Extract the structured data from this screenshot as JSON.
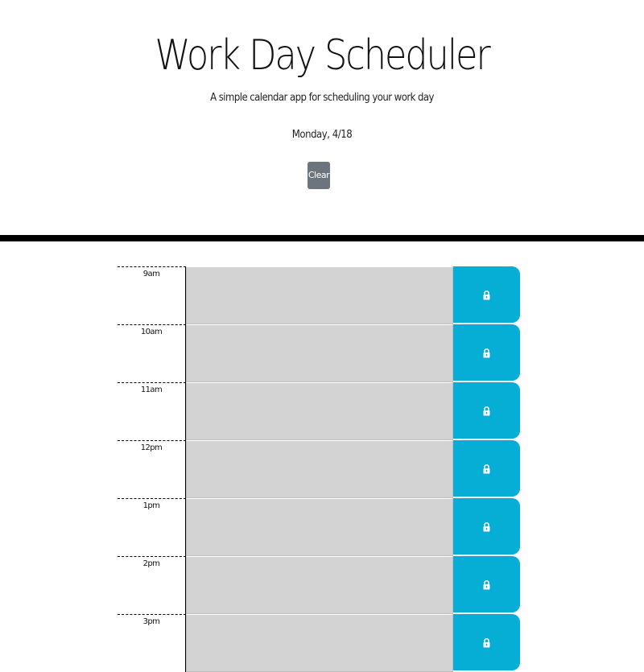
{
  "header": {
    "title": "Work Day Scheduler",
    "subtitle": "A simple calendar app for scheduling your work day",
    "date": "Monday, 4/18",
    "clear_label": "Clear"
  },
  "schedule": {
    "rows": [
      {
        "hour": "9am",
        "event": ""
      },
      {
        "hour": "10am",
        "event": ""
      },
      {
        "hour": "11am",
        "event": ""
      },
      {
        "hour": "12pm",
        "event": ""
      },
      {
        "hour": "1pm",
        "event": ""
      },
      {
        "hour": "2pm",
        "event": ""
      },
      {
        "hour": "3pm",
        "event": ""
      }
    ],
    "save_icon": "lock-icon"
  },
  "colors": {
    "clear_button": "#6c757d",
    "event_past": "#d3d3d3",
    "save_button": "#06aed5",
    "divider": "#000000"
  }
}
